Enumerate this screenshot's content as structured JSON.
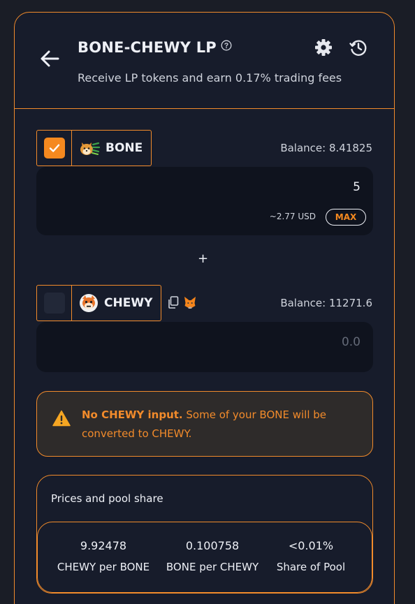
{
  "header": {
    "title": "BONE-CHEWY LP",
    "subtitle": "Receive LP tokens and earn 0.17% trading fees"
  },
  "token_a": {
    "name": "BONE",
    "selected": true,
    "balance": "Balance: 8.41825",
    "amount": "5",
    "usd": "~2.77 USD",
    "max_label": "MAX"
  },
  "plus": "+",
  "token_b": {
    "name": "CHEWY",
    "selected": false,
    "balance": "Balance: 11271.6",
    "amount_placeholder": "0.0"
  },
  "warning": {
    "bold": "No CHEWY input.",
    "text": " Some of your BONE will be converted to CHEWY."
  },
  "pool": {
    "title": "Prices and pool share",
    "stats": [
      {
        "value": "9.92478",
        "label": "CHEWY per BONE"
      },
      {
        "value": "0.100758",
        "label": "BONE per CHEWY"
      },
      {
        "value": "<0.01%",
        "label": "Share of Pool"
      }
    ]
  },
  "colors": {
    "accent": "#f28b2b",
    "checkbox_on": "#f5891f",
    "card_bg": "#171c2b",
    "input_bg": "#0f131e"
  },
  "icons": [
    "back-arrow-icon",
    "help-icon",
    "gear-icon",
    "history-icon",
    "check-icon",
    "bone-token-icon",
    "chewy-token-icon",
    "copy-icon",
    "metamask-icon",
    "warning-icon"
  ]
}
